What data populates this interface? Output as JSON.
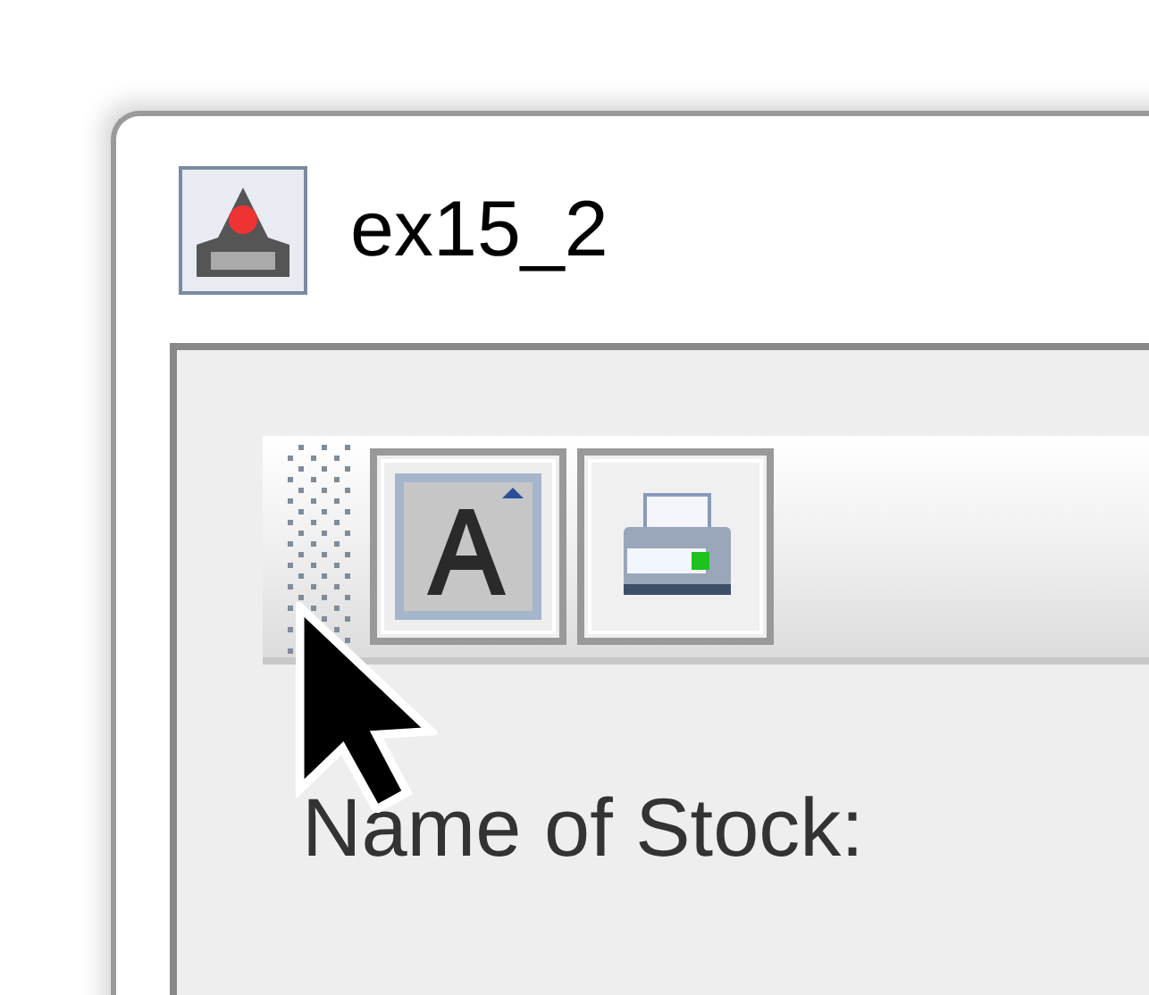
{
  "window": {
    "title": "ex15_2"
  },
  "toolbar": {
    "buttons": [
      {
        "kind": "font",
        "selected": true
      },
      {
        "kind": "print",
        "selected": false
      }
    ]
  },
  "label": "Name of Stock:"
}
